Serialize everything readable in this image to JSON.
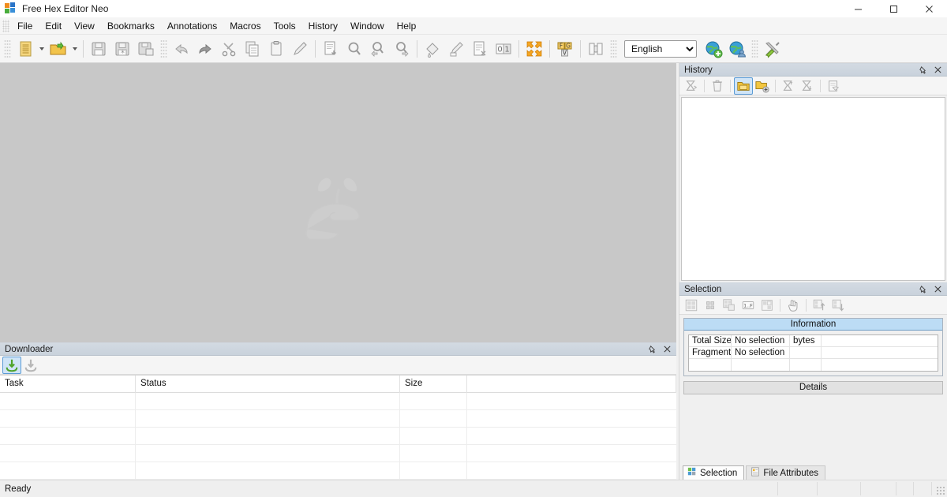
{
  "window": {
    "title": "Free Hex Editor Neo",
    "app_icon": "app-tiles-icon",
    "controls": [
      {
        "name": "minimize-button",
        "glyph": "minimize-icon"
      },
      {
        "name": "maximize-button",
        "glyph": "maximize-icon"
      },
      {
        "name": "close-button",
        "glyph": "close-icon"
      }
    ]
  },
  "menubar": {
    "items": [
      {
        "label": "File"
      },
      {
        "label": "Edit"
      },
      {
        "label": "View"
      },
      {
        "label": "Bookmarks"
      },
      {
        "label": "Annotations"
      },
      {
        "label": "Macros"
      },
      {
        "label": "Tools"
      },
      {
        "label": "History"
      },
      {
        "label": "Window"
      },
      {
        "label": "Help"
      }
    ]
  },
  "toolbar": {
    "language_value": "English",
    "language_options": [
      "English"
    ],
    "buttons": [
      {
        "name": "new-document-button",
        "icon": "new-document-icon"
      },
      {
        "name": "new-document-dropdown",
        "icon": "chevron-down-icon"
      },
      {
        "name": "open-file-button",
        "icon": "open-folder-icon"
      },
      {
        "name": "open-file-dropdown",
        "icon": "chevron-down-icon"
      },
      {
        "name": "save-button",
        "icon": "save-disk-icon"
      },
      {
        "name": "save-as-button",
        "icon": "save-as-disk-icon"
      },
      {
        "name": "save-all-button",
        "icon": "save-all-disk-icon"
      },
      {
        "name": "undo-button",
        "icon": "undo-arrow-icon"
      },
      {
        "name": "redo-button",
        "icon": "redo-arrow-icon"
      },
      {
        "name": "cut-button",
        "icon": "scissors-icon"
      },
      {
        "name": "copy-button",
        "icon": "copy-pages-icon"
      },
      {
        "name": "paste-button",
        "icon": "clipboard-icon"
      },
      {
        "name": "edit-pencil-button",
        "icon": "pencil-icon"
      },
      {
        "name": "goto-button",
        "icon": "document-arrow-down-icon"
      },
      {
        "name": "find-button",
        "icon": "magnifier-icon"
      },
      {
        "name": "find-previous-button",
        "icon": "magnifier-left-icon"
      },
      {
        "name": "find-next-button",
        "icon": "magnifier-right-icon"
      },
      {
        "name": "fill-button",
        "icon": "paint-can-icon"
      },
      {
        "name": "modify-button",
        "icon": "pencil-bytes-icon"
      },
      {
        "name": "clear-document-button",
        "icon": "document-cut-icon"
      },
      {
        "name": "binary-mode-button",
        "icon": "zero-one-icon"
      },
      {
        "name": "expand-selection-button",
        "icon": "four-arrows-icon"
      },
      {
        "name": "encoding-button",
        "icon": "fgv-letters-icon"
      },
      {
        "name": "compare-button",
        "icon": "two-pages-compare-icon"
      },
      {
        "name": "add-web-location-button",
        "icon": "globe-plus-icon"
      },
      {
        "name": "web-user-button",
        "icon": "globe-user-icon"
      },
      {
        "name": "settings-button",
        "icon": "tools-wrench-screwdriver-icon"
      }
    ]
  },
  "editor": {
    "watermark_icon": "hand-holding-sprout-icon"
  },
  "downloader": {
    "title": "Downloader",
    "pin_icon": "pin-icon",
    "close_icon": "close-icon",
    "toolbar": [
      {
        "name": "download-start-button",
        "icon": "download-green-icon",
        "active": true
      },
      {
        "name": "download-stop-button",
        "icon": "download-gray-icon",
        "active": false
      }
    ],
    "columns": [
      "Task",
      "Status",
      "Size",
      ""
    ],
    "rows": []
  },
  "history": {
    "title": "History",
    "pin_icon": "pin-icon",
    "close_icon": "close-icon",
    "toolbar": [
      {
        "name": "history-undo-filter-button",
        "icon": "hourglass-arrow-icon",
        "active": false
      },
      {
        "name": "history-clear-button",
        "icon": "trash-can-icon",
        "active": false
      },
      {
        "name": "history-branch-button",
        "icon": "yellow-branch-icon",
        "active": true
      },
      {
        "name": "history-new-branch-button",
        "icon": "yellow-branch-plus-icon",
        "active": false
      },
      {
        "name": "history-filter-up-button",
        "icon": "hourglass-up-icon",
        "active": false
      },
      {
        "name": "history-filter-down-button",
        "icon": "hourglass-down-icon",
        "active": false
      },
      {
        "name": "history-properties-button",
        "icon": "document-properties-icon",
        "active": false
      }
    ],
    "items": []
  },
  "selection": {
    "title": "Selection",
    "pin_icon": "pin-icon",
    "close_icon": "close-icon",
    "toolbar": [
      {
        "name": "selection-select-all-button",
        "icon": "grid-four-icon"
      },
      {
        "name": "selection-select-block-button",
        "icon": "grid-small-icon"
      },
      {
        "name": "selection-select-range-button",
        "icon": "grid-offset-icon"
      },
      {
        "name": "selection-select-expression-button",
        "icon": "one-to-f-icon"
      },
      {
        "name": "selection-invert-button",
        "icon": "grid-invert-icon"
      },
      {
        "name": "selection-pointer-button",
        "icon": "hand-pointer-icon"
      },
      {
        "name": "selection-load-button",
        "icon": "grid-up-arrow-icon"
      },
      {
        "name": "selection-save-button",
        "icon": "grid-down-arrow-icon"
      }
    ],
    "information_caption": "Information",
    "details_caption": "Details",
    "info_rows": [
      {
        "label": "Total Size",
        "value": "No selection",
        "unit": "bytes"
      },
      {
        "label": "Fragments",
        "value": "No selection",
        "unit": ""
      },
      {
        "label": "",
        "value": "",
        "unit": ""
      }
    ]
  },
  "bottom_tabs": [
    {
      "label": "Selection",
      "icon": "selection-grid-icon",
      "active": true
    },
    {
      "label": "File Attributes",
      "icon": "file-attributes-icon",
      "active": false
    }
  ],
  "statusbar": {
    "message": "Ready",
    "cells": [
      "",
      "",
      "",
      "",
      "",
      ""
    ],
    "resize_grip": "resize-grip-icon"
  },
  "colors": {
    "panel_header": "#cdd6e0",
    "accent_blue": "#5b9bd5",
    "group_caption": "#bcdcf5",
    "editor_bg": "#c8c8c8",
    "toolbar_bg": "#f5f5f5"
  }
}
